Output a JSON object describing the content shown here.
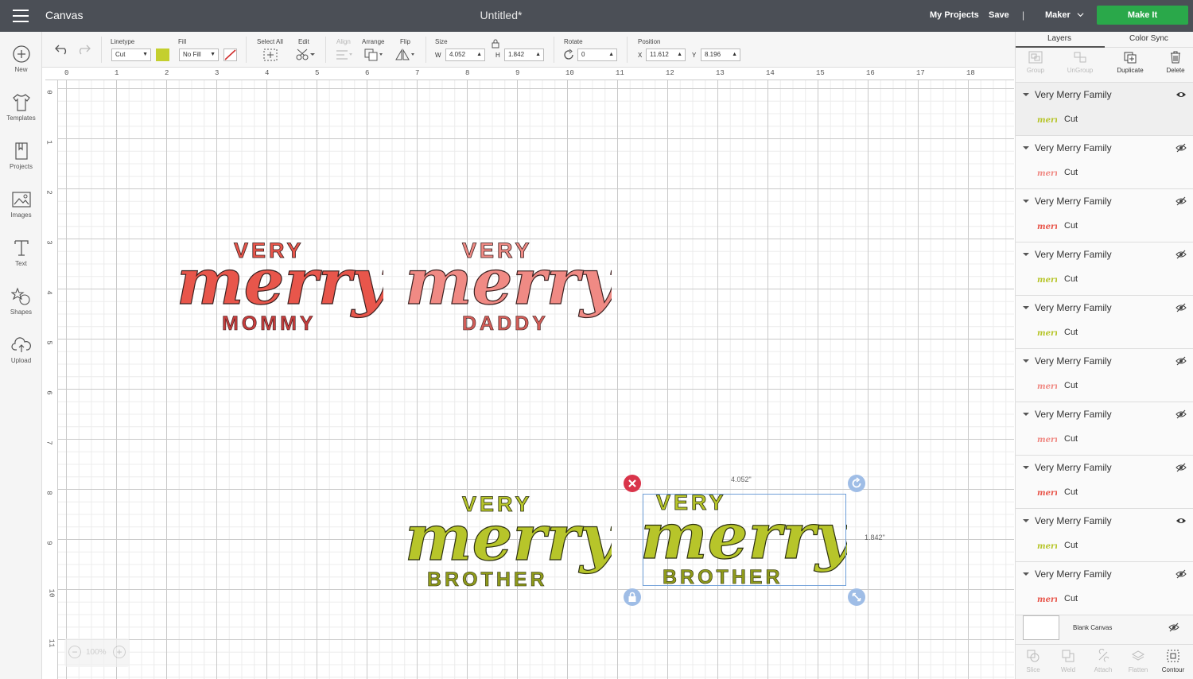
{
  "topbar": {
    "app_title": "Canvas",
    "doc_title": "Untitled*",
    "my_projects": "My Projects",
    "save": "Save",
    "divider": "|",
    "machine": "Maker",
    "make_it": "Make It"
  },
  "leftbar": {
    "items": [
      {
        "label": "New",
        "icon": "plus-circle-icon"
      },
      {
        "label": "Templates",
        "icon": "tshirt-icon"
      },
      {
        "label": "Projects",
        "icon": "projects-icon"
      },
      {
        "label": "Images",
        "icon": "images-icon"
      },
      {
        "label": "Text",
        "icon": "text-icon"
      },
      {
        "label": "Shapes",
        "icon": "shapes-icon"
      },
      {
        "label": "Upload",
        "icon": "cloud-upload-icon"
      }
    ]
  },
  "toolbar": {
    "linetype_label": "Linetype",
    "linetype_value": "Cut",
    "fill_label": "Fill",
    "fill_value": "No Fill",
    "linetype_color": "#c4cf2e",
    "select_all_label": "Select All",
    "edit_label": "Edit",
    "align_label": "Align",
    "arrange_label": "Arrange",
    "flip_label": "Flip",
    "size_label": "Size",
    "w_label": "W",
    "w_value": "4.052",
    "h_label": "H",
    "h_value": "1.842",
    "rotate_label": "Rotate",
    "rotate_value": "0",
    "position_label": "Position",
    "x_label": "X",
    "x_value": "11.612",
    "y_label": "Y",
    "y_value": "8.196"
  },
  "ruler": {
    "top": [
      "0",
      "1",
      "2",
      "3",
      "4",
      "5",
      "6",
      "7",
      "8",
      "9",
      "10",
      "11",
      "12",
      "13",
      "14",
      "15",
      "16",
      "17",
      "18"
    ],
    "left": [
      "0",
      "1",
      "2",
      "3",
      "4",
      "5",
      "6",
      "7",
      "8",
      "9",
      "10",
      "11"
    ]
  },
  "designs": [
    {
      "top": "VERY",
      "script": "merry",
      "bottom": "MOMMY",
      "color": "#e8564b",
      "text_color": "#c63d3d"
    },
    {
      "top": "VERY",
      "script": "merry",
      "bottom": "DADDY",
      "color": "#f08a84",
      "text_color": "#d25d58"
    },
    {
      "top": "VERY",
      "script": "merry",
      "bottom": "BROTHER",
      "color": "#b7c52a",
      "text_color": "#8f9a1b"
    },
    {
      "top": "VERY",
      "script": "merry",
      "bottom": "BROTHER",
      "color": "#b7c52a",
      "text_color": "#8f9a1b"
    }
  ],
  "selection": {
    "width_label": "4.052\"",
    "height_label": "1.842\""
  },
  "zoom": {
    "value": "100%"
  },
  "rightpanel": {
    "tabs": [
      "Layers",
      "Color Sync"
    ],
    "actions": [
      {
        "label": "Group",
        "enabled": false
      },
      {
        "label": "UnGroup",
        "enabled": false
      },
      {
        "label": "Duplicate",
        "enabled": true
      },
      {
        "label": "Delete",
        "enabled": true
      }
    ],
    "layers": [
      {
        "title": "Very Merry Family",
        "op": "Cut",
        "visible": true,
        "thumb_color": "#b7c52a",
        "selected": true
      },
      {
        "title": "Very Merry Family",
        "op": "Cut",
        "visible": false,
        "thumb_color": "#f08a84",
        "selected": false
      },
      {
        "title": "Very Merry Family",
        "op": "Cut",
        "visible": false,
        "thumb_color": "#e8564b",
        "selected": false
      },
      {
        "title": "Very Merry Family",
        "op": "Cut",
        "visible": false,
        "thumb_color": "#b7c52a",
        "selected": false
      },
      {
        "title": "Very Merry Family",
        "op": "Cut",
        "visible": false,
        "thumb_color": "#b7c52a",
        "selected": false
      },
      {
        "title": "Very Merry Family",
        "op": "Cut",
        "visible": false,
        "thumb_color": "#f08a84",
        "selected": false
      },
      {
        "title": "Very Merry Family",
        "op": "Cut",
        "visible": false,
        "thumb_color": "#f08a84",
        "selected": false
      },
      {
        "title": "Very Merry Family",
        "op": "Cut",
        "visible": false,
        "thumb_color": "#e8564b",
        "selected": false
      },
      {
        "title": "Very Merry Family",
        "op": "Cut",
        "visible": true,
        "thumb_color": "#b7c52a",
        "selected": false
      },
      {
        "title": "Very Merry Family",
        "op": "Cut",
        "visible": false,
        "thumb_color": "#e8564b",
        "selected": false
      }
    ],
    "blank_canvas": "Blank Canvas",
    "bottom_actions": [
      {
        "label": "Slice",
        "enabled": false
      },
      {
        "label": "Weld",
        "enabled": false
      },
      {
        "label": "Attach",
        "enabled": false
      },
      {
        "label": "Flatten",
        "enabled": false
      },
      {
        "label": "Contour",
        "enabled": true
      }
    ]
  }
}
